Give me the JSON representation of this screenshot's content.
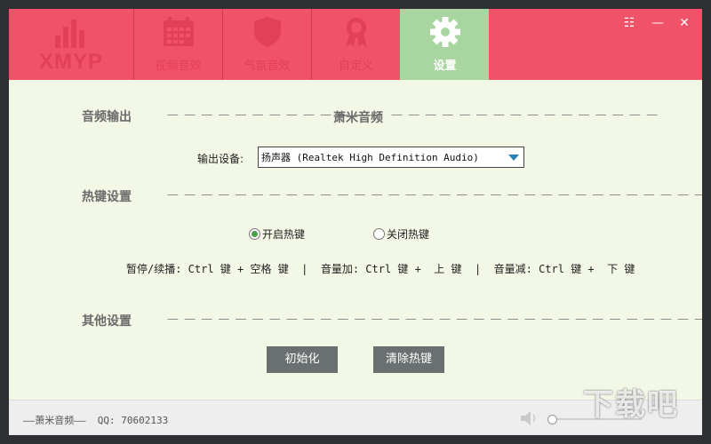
{
  "header": {
    "logo_text": "XMYP",
    "tabs": [
      {
        "label": "视频音效",
        "icon": "calendar-icon",
        "active": false
      },
      {
        "label": "气氛音效",
        "icon": "shield-icon",
        "active": false
      },
      {
        "label": "自定义",
        "icon": "award-ribbon-icon",
        "active": false
      },
      {
        "label": "设置",
        "icon": "gear-icon",
        "active": true
      }
    ],
    "window_controls": {
      "menu": "☷",
      "minimize": "—",
      "close": "✕"
    }
  },
  "audio_output": {
    "title": "音频输出",
    "brand": "萧米音频",
    "device_label": "输出设备:",
    "device_value": "扬声器 (Realtek High Definition Audio)"
  },
  "hotkeys": {
    "title": "热键设置",
    "enable_label": "开启热键",
    "disable_label": "关闭热键",
    "enabled": true,
    "list_text": "暂停/续播: Ctrl 键 + 空格 键  |  音量加: Ctrl 键 +  上 键  |  音量减: Ctrl 键 +  下 键"
  },
  "other": {
    "title": "其他设置",
    "init_button": "初始化",
    "clear_button": "清除热键"
  },
  "footer": {
    "brand_text": "——萧米音频——  QQ: 70602133",
    "volume": 0.0
  },
  "watermark": "下载吧",
  "colors": {
    "header": "#f0526a",
    "active_tab": "#a9d6a0",
    "panel": "#f2f7e6",
    "button": "#6a6f70"
  }
}
